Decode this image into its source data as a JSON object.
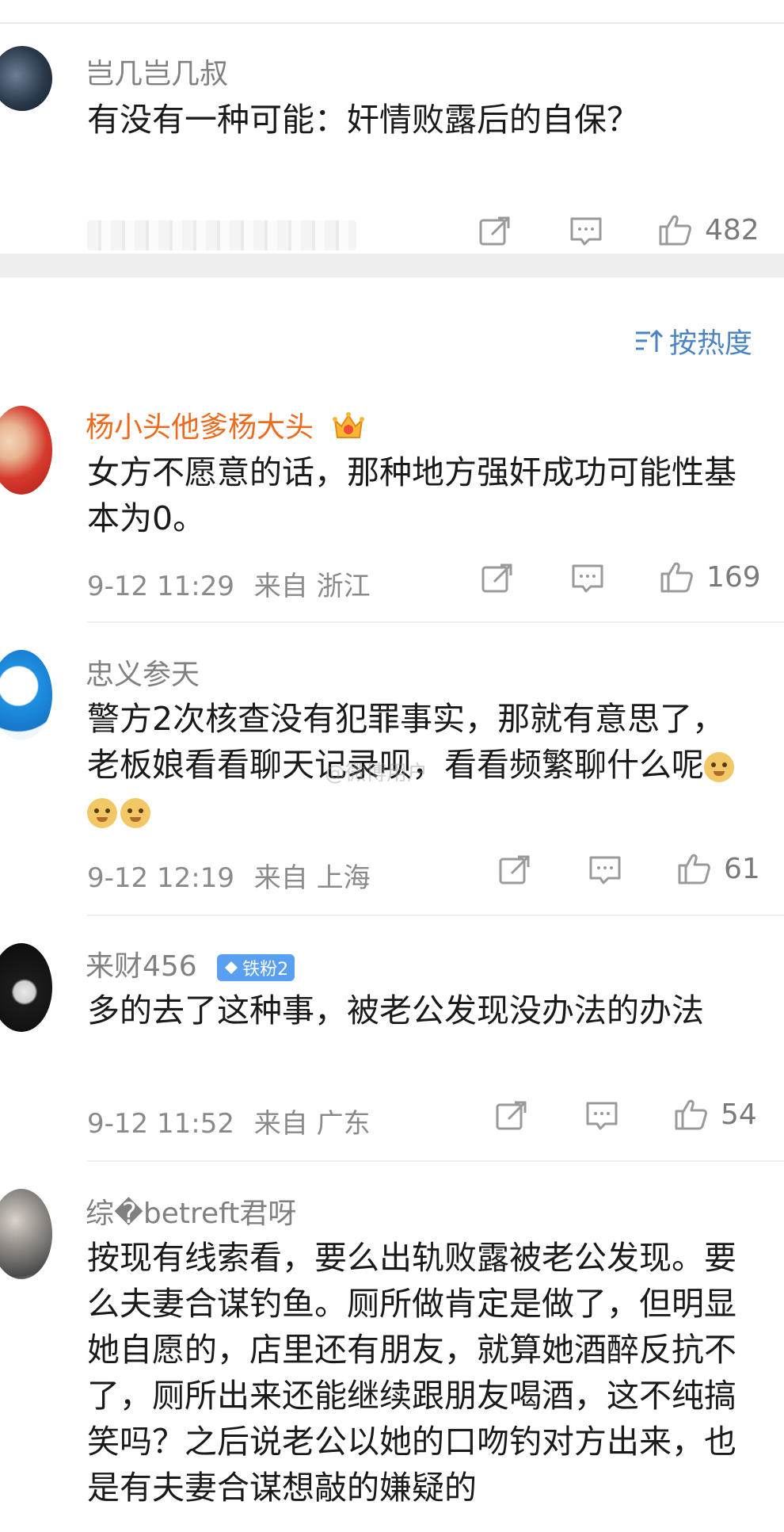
{
  "post": {
    "author": "岂几岂几叔",
    "text": "有没有一种可能：奸情败露后的自保？",
    "likes": "482",
    "icons": [
      "share-icon",
      "comment-icon",
      "like-icon"
    ]
  },
  "sort": {
    "label": "按热度",
    "icon": "sort-icon"
  },
  "comments": [
    {
      "name": "杨小头他爹杨大头",
      "vip": true,
      "text": "女方不愿意的话，那种地方强奸成功可能性基本为0。",
      "time": "9-12 11:29",
      "from": "来自 浙江",
      "likes": "169"
    },
    {
      "name": "忠义参天",
      "text": "警方2次核查没有犯罪事实，那就有意思了，老板娘看看聊天记录呗，看看频繁聊什么呢",
      "time": "9-12 12:19",
      "from": "来自 上海",
      "likes": "61"
    },
    {
      "name": "来财456",
      "badge": "铁粉2",
      "text": "多的去了这种事，被老公发现没办法的办法",
      "time": "9-12 11:52",
      "from": "来自 广东",
      "likes": "54"
    },
    {
      "name": "综�betreft君呀",
      "text": "按现有线索看，要么出轨败露被老公发现。要么夫妻合谋钓鱼。厕所做肯定是做了，但明显她自愿的，店里还有朋友，就算她酒醉反抗不了，厕所出来还能继续跟朋友喝酒，这不纯搞笑吗？之后说老公以她的口吻钓对方出来，也是有夫妻合谋想敲的嫌疑的"
    }
  ],
  "colors": {
    "vip_name": "#ef6a1d",
    "sort": "#4a84c4",
    "badge": "#5aa0f0"
  }
}
